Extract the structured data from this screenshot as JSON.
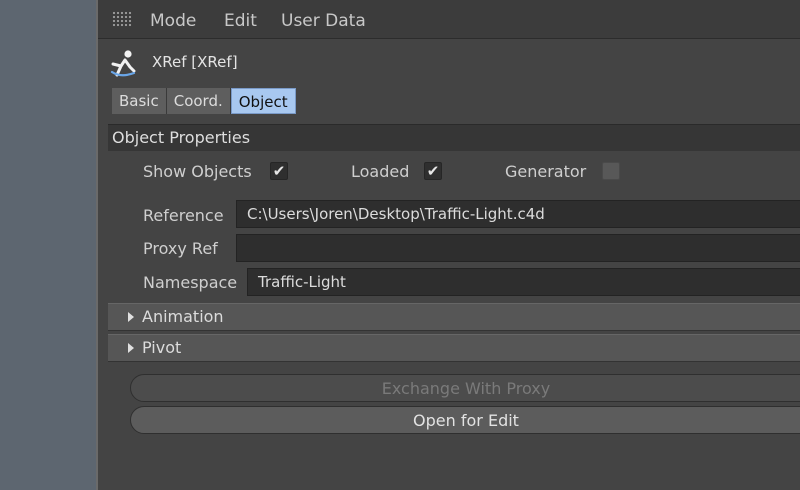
{
  "menu": {
    "items": [
      "Mode",
      "Edit",
      "User Data"
    ]
  },
  "object": {
    "title": "XRef [XRef]",
    "icon": "xref-object-icon"
  },
  "tabs": [
    "Basic",
    "Coord.",
    "Object"
  ],
  "active_tab": "Object",
  "section": {
    "title": "Object Properties"
  },
  "options": {
    "show_objects": {
      "label": "Show Objects",
      "checked": true
    },
    "loaded": {
      "label": "Loaded",
      "checked": true
    },
    "generator": {
      "label": "Generator",
      "checked": false
    }
  },
  "fields": {
    "reference": {
      "label": "Reference",
      "value": "C:\\Users\\Joren\\Desktop\\Traffic-Light.c4d"
    },
    "proxy_ref": {
      "label": "Proxy Ref",
      "value": ""
    },
    "namespace": {
      "label": "Namespace",
      "value": "Traffic-Light"
    }
  },
  "groups": {
    "animation": "Animation",
    "pivot": "Pivot"
  },
  "buttons": {
    "exchange": "Exchange With Proxy",
    "open_edit": "Open for Edit"
  },
  "colors": {
    "active_tab": "#a8c8f0",
    "panel_bg": "#444444",
    "left_strip": "#5d6670"
  }
}
